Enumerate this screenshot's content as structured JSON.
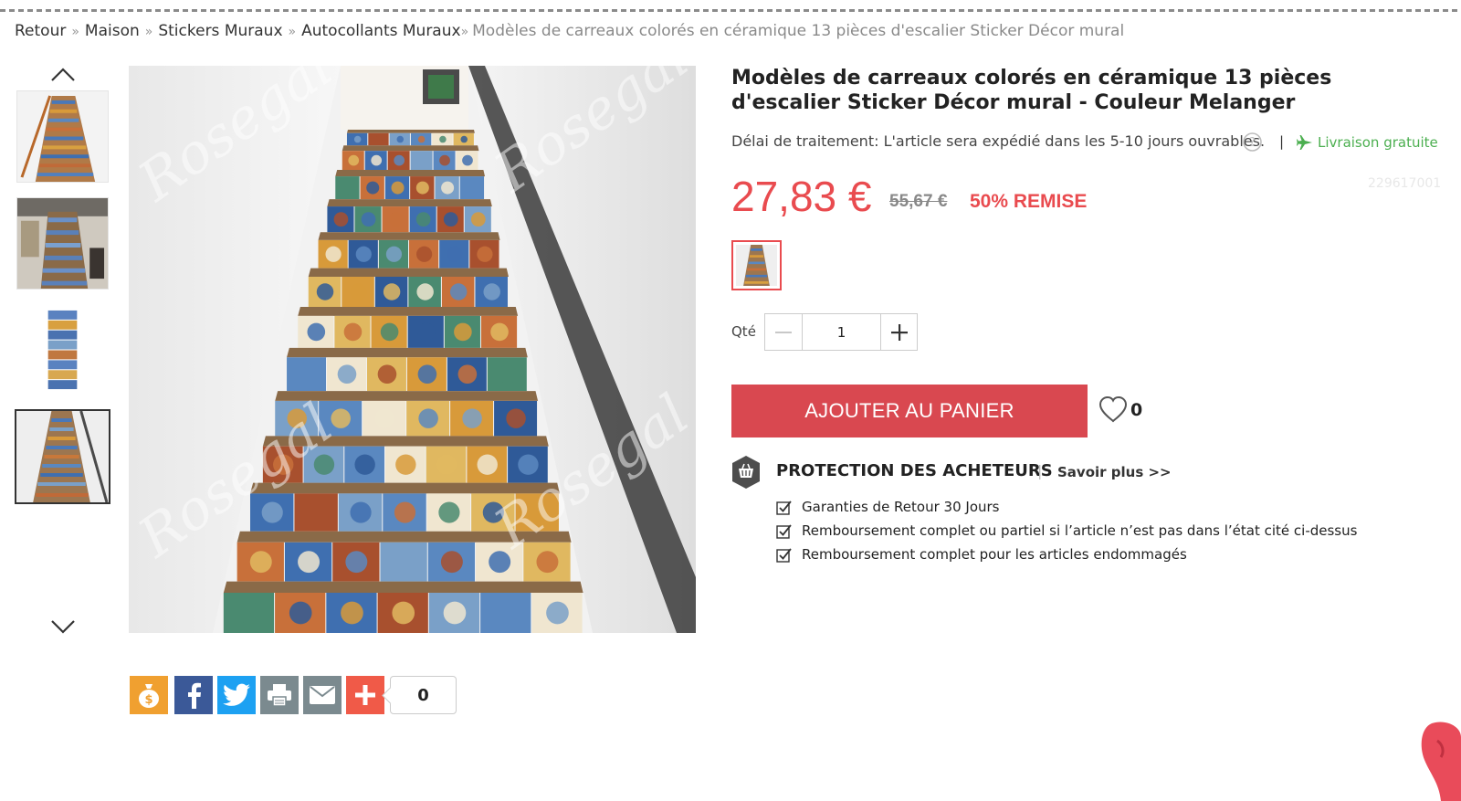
{
  "breadcrumb": {
    "items": [
      "Retour",
      "Maison",
      "Stickers Muraux",
      "Autocollants Muraux"
    ],
    "separator": "»",
    "current": "Modèles de carreaux colorés en céramique 13 pièces d'escalier Sticker Décor mural"
  },
  "gallery": {
    "thumbnails": [
      {
        "icon": "staircase-thumb-1"
      },
      {
        "icon": "staircase-thumb-2"
      },
      {
        "icon": "staircase-thumb-3"
      },
      {
        "icon": "staircase-thumb-4",
        "active": true
      }
    ],
    "up_arrow_icon": "chevron-up-icon",
    "down_arrow_icon": "chevron-down-icon",
    "watermark": "Rosegal"
  },
  "product": {
    "title": "Modèles de carreaux colorés en céramique 13 pièces d'escalier Sticker Décor mural - Couleur Melanger",
    "processing": "Délai de traitement: L'article sera expédié dans les 5-10 jours ouvrables.",
    "pipe": "|",
    "free_shipping": "Livraison gratuite",
    "sku": "229617001",
    "price": "27,83 €",
    "old_price": "55,67 €",
    "discount": "50% REMISE",
    "qty_label": "Qté",
    "qty_value": "1",
    "add_to_cart": "AJOUTER AU PANIER",
    "wishlist_count": "0"
  },
  "protection": {
    "title": "PROTECTION DES ACHETEURS",
    "pipe": "|",
    "learn_more": "Savoir plus >>",
    "items": [
      "Garanties de Retour 30 Jours",
      "Remboursement complet ou partiel si l’article n’est pas dans l’état cité ci-dessus",
      "Remboursement complet pour les articles endommagés"
    ]
  },
  "share": {
    "buttons": [
      {
        "name": "money-bag-icon",
        "color": "#f0a030"
      },
      {
        "name": "facebook-icon",
        "color": "#3b5998"
      },
      {
        "name": "twitter-icon",
        "color": "#1da1f2"
      },
      {
        "name": "print-icon",
        "color": "#7b8a8f"
      },
      {
        "name": "email-icon",
        "color": "#7b8a8f"
      },
      {
        "name": "plus-share-icon",
        "color": "#f05a48"
      }
    ],
    "count": "0"
  },
  "colors": {
    "accent": "#e94b4f",
    "cart_button": "#d94850",
    "free_shipping": "#4caf50"
  }
}
